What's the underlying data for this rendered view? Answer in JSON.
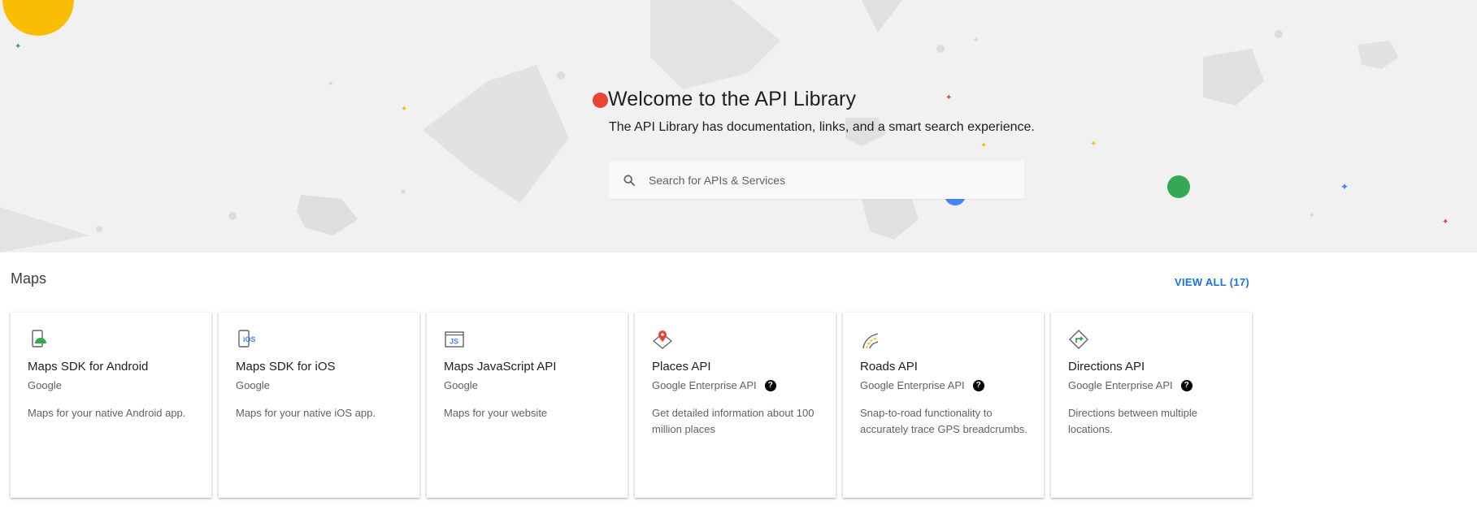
{
  "hero": {
    "title": "Welcome to the API Library",
    "subtitle": "The API Library has documentation, links, and a smart search experience.",
    "accent_colors": {
      "red": "#ea4335",
      "green": "#34a853",
      "blue": "#4285f4",
      "yellow": "#fbbc04"
    }
  },
  "search": {
    "placeholder": "Search for APIs & Services",
    "icon": "search-icon"
  },
  "section": {
    "title": "Maps",
    "view_all": "VIEW ALL (17)"
  },
  "cards": [
    {
      "name": "Maps SDK for Android",
      "provider": "Google",
      "description": "Maps for your native Android app.",
      "icon": "android-map-icon",
      "help": false
    },
    {
      "name": "Maps SDK for iOS",
      "provider": "Google",
      "description": "Maps for your native iOS app.",
      "icon": "ios-map-icon",
      "help": false
    },
    {
      "name": "Maps JavaScript API",
      "provider": "Google",
      "description": "Maps for your website",
      "icon": "javascript-icon",
      "help": false
    },
    {
      "name": "Places API",
      "provider": "Google Enterprise API",
      "description": "Get detailed information about 100 million places",
      "icon": "place-pin-icon",
      "help": true
    },
    {
      "name": "Roads API",
      "provider": "Google Enterprise API",
      "description": "Snap-to-road functionality to accurately trace GPS breadcrumbs.",
      "icon": "roads-icon",
      "help": true
    },
    {
      "name": "Directions API",
      "provider": "Google Enterprise API",
      "description": "Directions between multiple locations.",
      "icon": "directions-icon",
      "help": true
    }
  ],
  "help_glyph": "?",
  "ios_glyph": "iOS",
  "js_glyph": "JS"
}
